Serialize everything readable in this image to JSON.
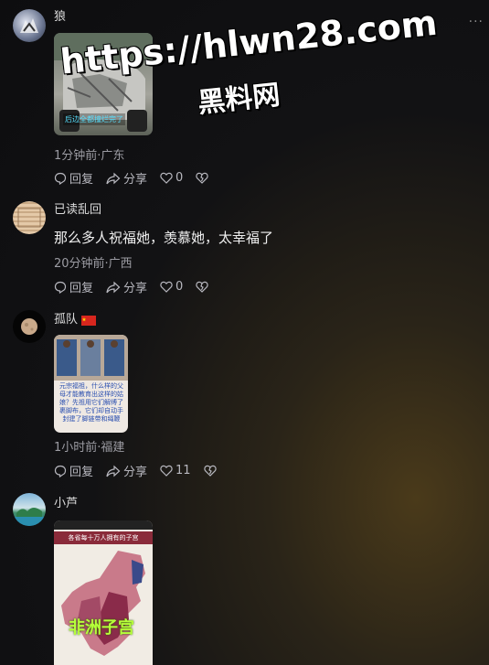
{
  "watermark": {
    "url": "https://hlwn28.com",
    "name": "黑料网"
  },
  "more_label": "···",
  "comments": [
    {
      "user": "狼",
      "meta": "1分钟前·广东",
      "image_caption": "后边全都撞烂完了",
      "reply_label": "回复",
      "share_label": "分享",
      "likes": "0"
    },
    {
      "user": "已读乱回",
      "text": "那么多人祝福她，羡慕她，太幸福了",
      "meta": "20分钟前·广西",
      "reply_label": "回复",
      "share_label": "分享",
      "likes": "0"
    },
    {
      "user": "孤队",
      "meta": "1小时前·福建",
      "image_caption": "元宗福祖，什么样的父母才能教育出这样的姑娘？先祖用它们解缚了裹脚布，它们却自动手封建了脚链带和绳鞭",
      "reply_label": "回复",
      "share_label": "分享",
      "likes": "11"
    },
    {
      "user": "小芦",
      "image_header": "各省每十万人拥有的子宫",
      "image_overlay": "非洲子宫"
    }
  ],
  "colors": {
    "accent_flag": "#d7261e",
    "bg": "#121214",
    "muted": "#9c9ca3"
  }
}
